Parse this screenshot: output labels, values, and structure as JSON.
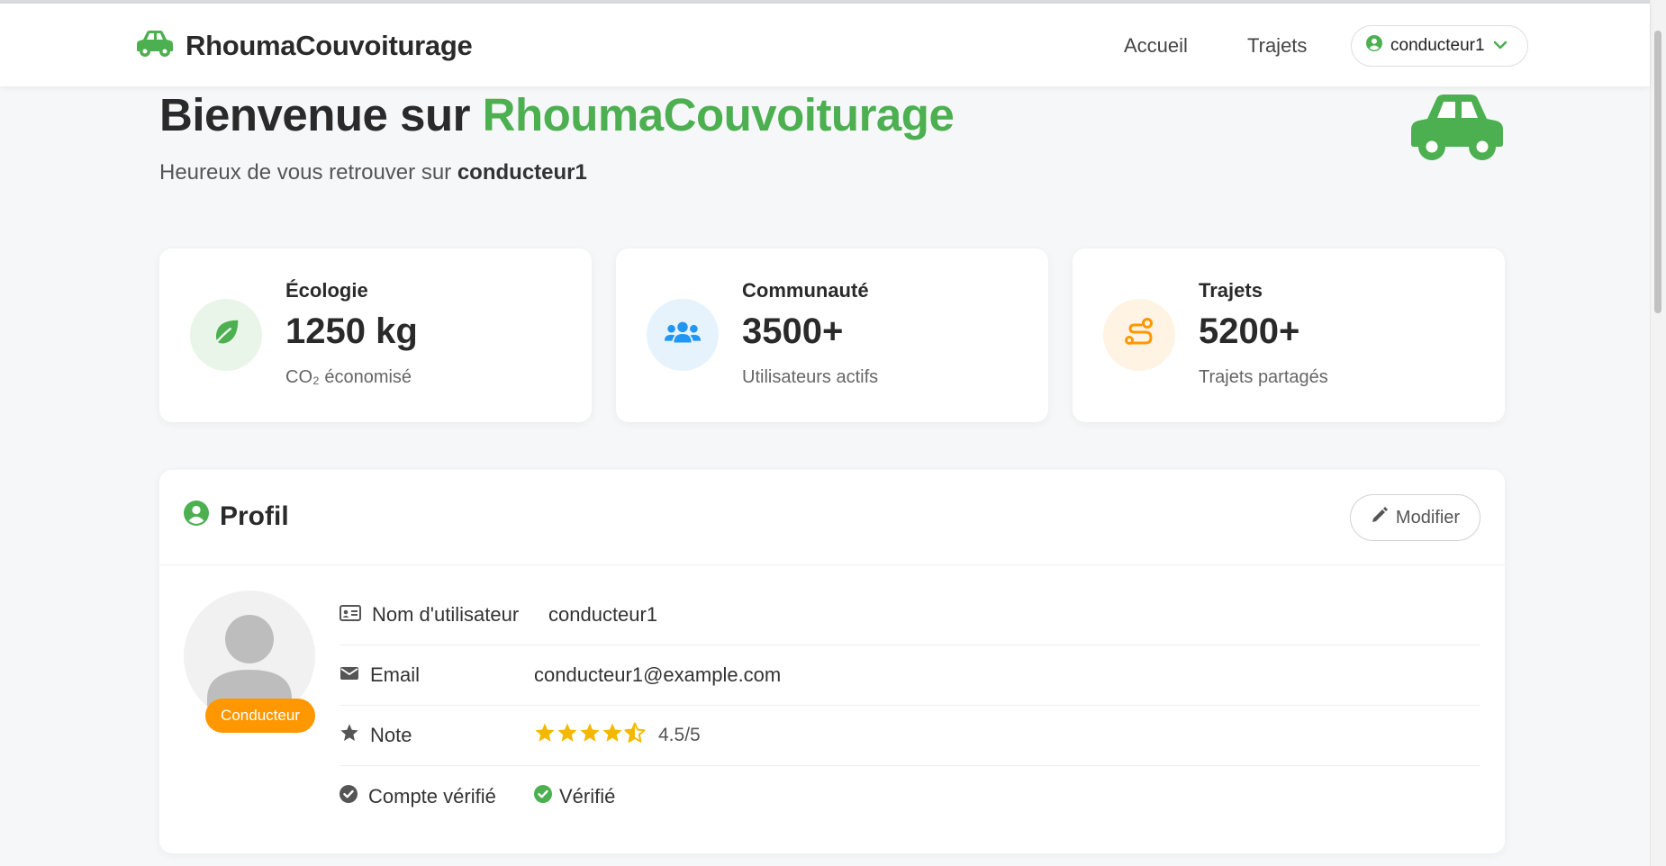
{
  "brand": {
    "name": "RhoumaCouvoiturage"
  },
  "nav": {
    "links": [
      "Accueil",
      "Trajets"
    ],
    "user": "conducteur1"
  },
  "hero": {
    "title_prefix": "Bienvenue sur",
    "title_accent": "RhoumaCouvoiturage",
    "subtitle_prefix": "Heureux de vous retrouver sur",
    "subtitle_user": "conducteur1"
  },
  "stats": [
    {
      "label": "Écologie",
      "value": "1250 kg",
      "desc": "CO₂ économisé",
      "icon": "leaf-icon",
      "color": "#4caf50",
      "bg": "#eaf5ea"
    },
    {
      "label": "Communauté",
      "value": "3500+",
      "desc": "Utilisateurs actifs",
      "icon": "users-icon",
      "color": "#2196f3",
      "bg": "#e6f3fd"
    },
    {
      "label": "Trajets",
      "value": "5200+",
      "desc": "Trajets partagés",
      "icon": "route-icon",
      "color": "#ff9800",
      "bg": "#fff3e4"
    }
  ],
  "profile": {
    "title": "Profil",
    "edit_label": "Modifier",
    "role": "Conducteur",
    "rows": {
      "username": {
        "label": "Nom d'utilisateur",
        "value": "conducteur1"
      },
      "email": {
        "label": "Email",
        "value": "conducteur1@example.com"
      },
      "note": {
        "label": "Note",
        "rating": 4.5,
        "value": "4.5/5"
      },
      "verified": {
        "label": "Compte vérifié",
        "value": "Vérifié"
      }
    }
  },
  "colors": {
    "accent": "#4caf50",
    "orange": "#ff9800",
    "star": "#f5b800"
  }
}
